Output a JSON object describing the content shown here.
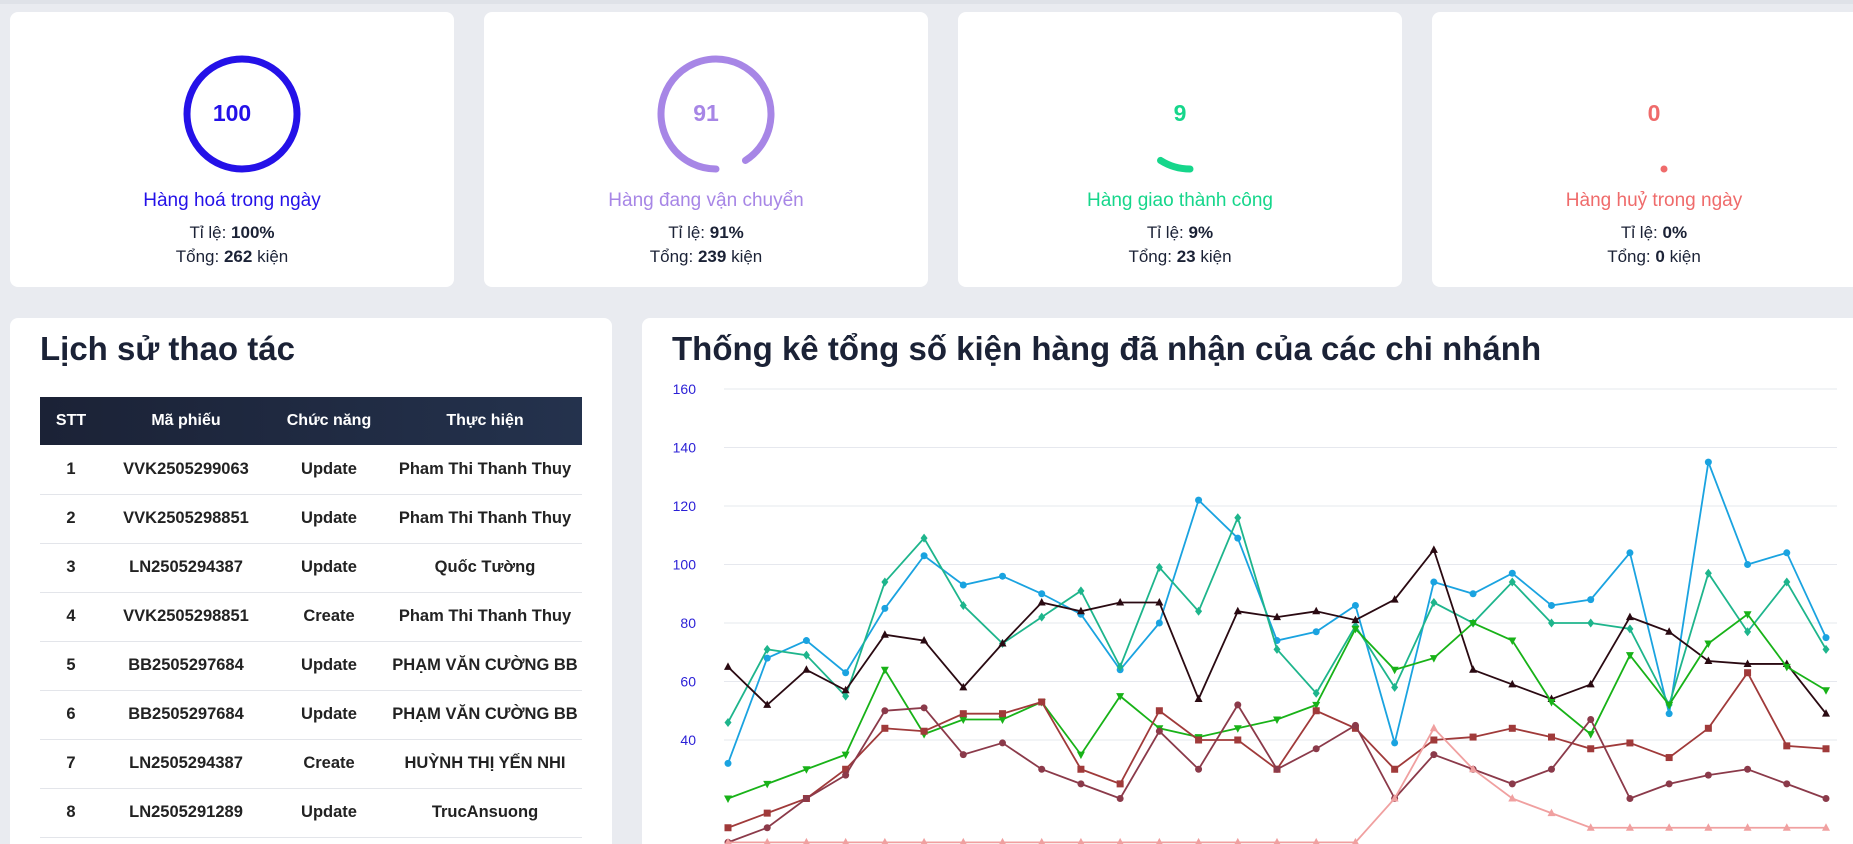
{
  "stats": [
    {
      "value": "100",
      "title": "Hàng hoá trong ngày",
      "rate_label": "Tỉ lệ:",
      "rate": "100%",
      "total_label": "Tổng:",
      "total": "262",
      "unit": "kiện",
      "progress": 1.0,
      "color": "#2411e8"
    },
    {
      "value": "91",
      "title": "Hàng đang vận chuyển",
      "rate_label": "Tỉ lệ:",
      "rate": "91%",
      "total_label": "Tổng:",
      "total": "239",
      "unit": "kiện",
      "progress": 0.91,
      "color": "#a786e6"
    },
    {
      "value": "9",
      "title": "Hàng giao thành công",
      "rate_label": "Tỉ lệ:",
      "rate": "9%",
      "total_label": "Tổng:",
      "total": "23",
      "unit": "kiện",
      "progress": 0.09,
      "color": "#16d68b"
    },
    {
      "value": "0",
      "title": "Hàng huỷ trong ngày",
      "rate_label": "Tỉ lệ:",
      "rate": "0%",
      "total_label": "Tổng:",
      "total": "0",
      "unit": "kiện",
      "progress": 0.0,
      "color": "#ef6b6b"
    }
  ],
  "history": {
    "title": "Lịch sử thao tác",
    "columns": [
      "STT",
      "Mã phiếu",
      "Chức năng",
      "Thực hiện"
    ],
    "rows": [
      [
        "1",
        "VVK2505299063",
        "Update",
        "Pham Thi Thanh Thuy"
      ],
      [
        "2",
        "VVK2505298851",
        "Update",
        "Pham Thi Thanh Thuy"
      ],
      [
        "3",
        "LN2505294387",
        "Update",
        "Quốc Tường"
      ],
      [
        "4",
        "VVK2505298851",
        "Create",
        "Pham Thi Thanh Thuy"
      ],
      [
        "5",
        "BB2505297684",
        "Update",
        "PHẠM VĂN CƯỜNG BB"
      ],
      [
        "6",
        "BB2505297684",
        "Update",
        "PHẠM VĂN CƯỜNG BB"
      ],
      [
        "7",
        "LN2505294387",
        "Create",
        "HUỲNH THỊ YẾN NHI"
      ],
      [
        "8",
        "LN2505291289",
        "Update",
        "TrucAnsuong"
      ]
    ]
  },
  "chart": {
    "title": "Thống kê tổng số kiện hàng đã nhận của các chi nhánh"
  },
  "chart_data": {
    "type": "line",
    "y_ticks": [
      40,
      60,
      80,
      100,
      120,
      140,
      160
    ],
    "ylim": [
      40,
      160
    ],
    "grid": true,
    "x_count": 29,
    "series": [
      {
        "color": "#1aa3e0",
        "marker": "circle",
        "values": [
          32,
          68,
          74,
          63,
          85,
          103,
          93,
          96,
          90,
          83,
          64,
          80,
          122,
          109,
          74,
          77,
          86,
          39,
          94,
          90,
          97,
          86,
          88,
          104,
          49,
          135,
          100,
          104,
          75
        ]
      },
      {
        "color": "#1eb58c",
        "marker": "diamond",
        "values": [
          46,
          71,
          69,
          55,
          94,
          109,
          86,
          73,
          82,
          91,
          65,
          99,
          84,
          116,
          71,
          56,
          79,
          58,
          87,
          80,
          94,
          80,
          80,
          78,
          52,
          97,
          77,
          94,
          71
        ]
      },
      {
        "color": "#2a0a12",
        "marker": "triangle",
        "values": [
          65,
          52,
          64,
          57,
          76,
          74,
          58,
          73,
          87,
          84,
          87,
          87,
          54,
          84,
          82,
          84,
          81,
          88,
          105,
          64,
          59,
          54,
          59,
          82,
          77,
          67,
          66,
          66,
          49
        ]
      },
      {
        "color": "#18b218",
        "marker": "tri-down",
        "values": [
          20,
          25,
          30,
          35,
          64,
          42,
          47,
          47,
          53,
          35,
          55,
          44,
          41,
          44,
          47,
          52,
          78,
          64,
          68,
          80,
          74,
          53,
          42,
          69,
          52,
          73,
          83,
          65,
          57
        ]
      },
      {
        "color": "#a03a3a",
        "marker": "square",
        "values": [
          10,
          15,
          20,
          30,
          44,
          43,
          49,
          49,
          53,
          30,
          25,
          50,
          40,
          40,
          30,
          50,
          44,
          30,
          40,
          41,
          44,
          41,
          37,
          39,
          34,
          44,
          63,
          38,
          37
        ]
      },
      {
        "color": "#8b3a4a",
        "marker": "circle",
        "values": [
          5,
          10,
          20,
          28,
          50,
          51,
          35,
          39,
          30,
          25,
          20,
          43,
          30,
          52,
          30,
          37,
          45,
          20,
          35,
          30,
          25,
          30,
          47,
          20,
          25,
          28,
          30,
          25,
          20
        ]
      },
      {
        "color": "#f0a0a0",
        "marker": "triangle",
        "values": [
          5,
          5,
          5,
          5,
          5,
          5,
          5,
          5,
          5,
          5,
          5,
          5,
          5,
          5,
          5,
          5,
          5,
          20,
          44,
          30,
          20,
          15,
          10,
          10,
          10,
          10,
          10,
          10,
          10
        ]
      }
    ]
  }
}
